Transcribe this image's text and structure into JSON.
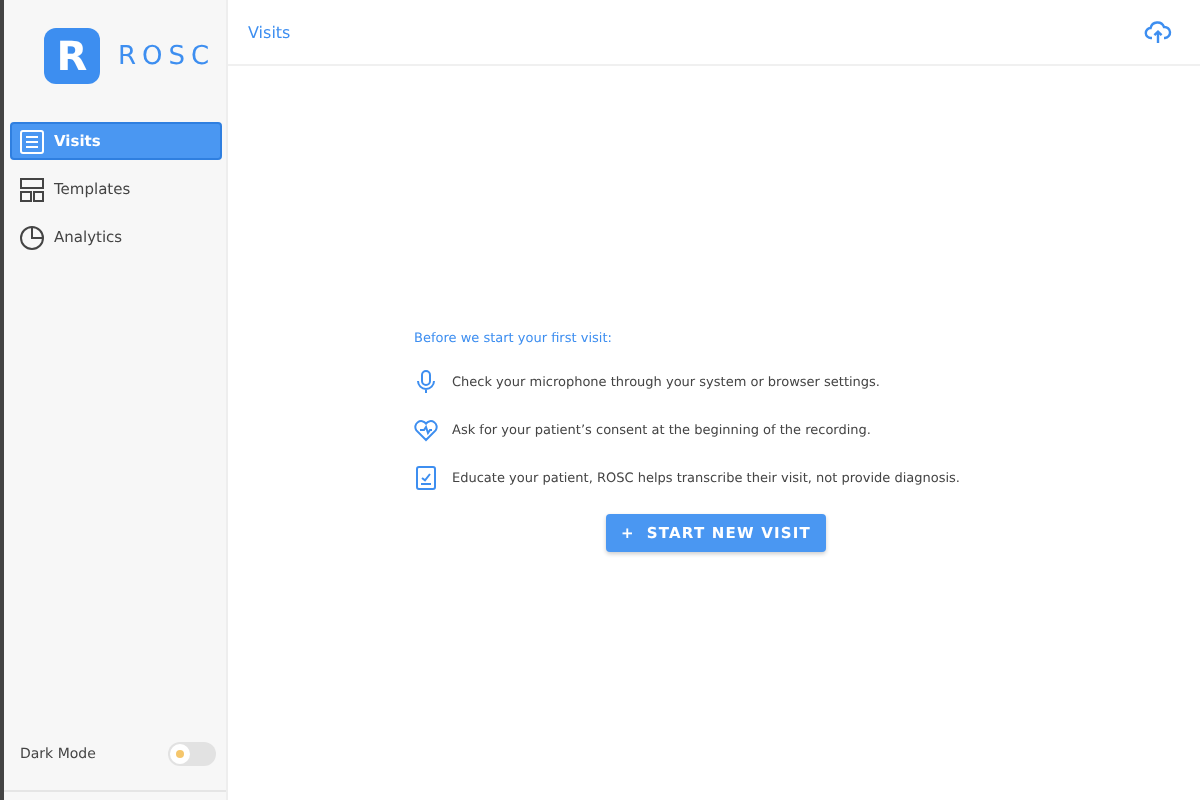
{
  "logo": {
    "letter": "R",
    "name": "ROSC"
  },
  "sidebar": {
    "items": [
      {
        "label": "Visits",
        "kind": "list",
        "selected": true
      },
      {
        "label": "Templates",
        "kind": "layout",
        "selected": false
      },
      {
        "label": "Analytics",
        "kind": "pie",
        "selected": false
      }
    ],
    "dark_mode": {
      "label": "Dark Mode",
      "on": false
    }
  },
  "header": {
    "title": "Visits"
  },
  "intro": "Before we start your first visit:",
  "tips": [
    {
      "kind": "mic",
      "text": "Check your microphone through your system or browser settings."
    },
    {
      "kind": "heart",
      "text": "Ask for your patient’s consent at the beginning of the recording."
    },
    {
      "kind": "doc",
      "text": "Educate your patient, ROSC helps transcribe their visit, not provide diagnosis."
    }
  ],
  "button": {
    "icon": "+",
    "label": "START NEW VISIT"
  }
}
